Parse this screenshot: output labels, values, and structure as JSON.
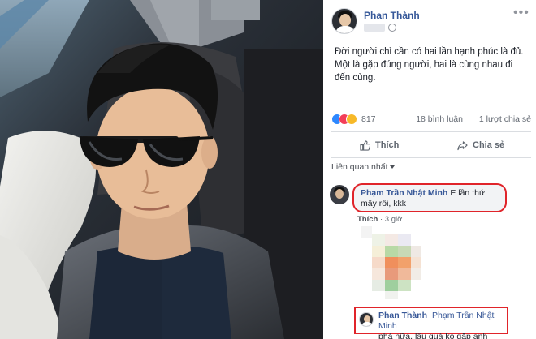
{
  "post": {
    "author": "Phan Thành",
    "text": "Đời người chỉ cần có hai lần hạnh phúc là đủ. Một là gặp đúng người, hai là cùng nhau đi đến cùng.",
    "reaction_count": "817",
    "comment_count": "18 bình luận",
    "share_count": "1 lượt chia sẻ"
  },
  "actions": {
    "like_label": "Thích",
    "share_label": "Chia sẻ"
  },
  "comments_filter": "Liên quan nhất",
  "comments": [
    {
      "author": "Phạm Trần Nhật Minh",
      "text": "E lần thứ mấy rồi, kkk",
      "like_label": "Thích",
      "time": "3 giờ"
    }
  ],
  "reply": {
    "author": "Phan Thành",
    "tagged": "Phạm Trần Nhật Minh",
    "text": "phá nữa, lâu quá ko gặp anh"
  },
  "colors": {
    "link_blue": "#365899",
    "highlight_red": "#e0242a",
    "like_blue": "#2d88ff",
    "love_red": "#f33e58",
    "haha_yellow": "#f7b928"
  },
  "icons": [
    "globe-icon",
    "more-options-icon",
    "like-icon",
    "share-icon",
    "love-reaction-icon",
    "haha-reaction-icon",
    "like-reaction-icon"
  ]
}
